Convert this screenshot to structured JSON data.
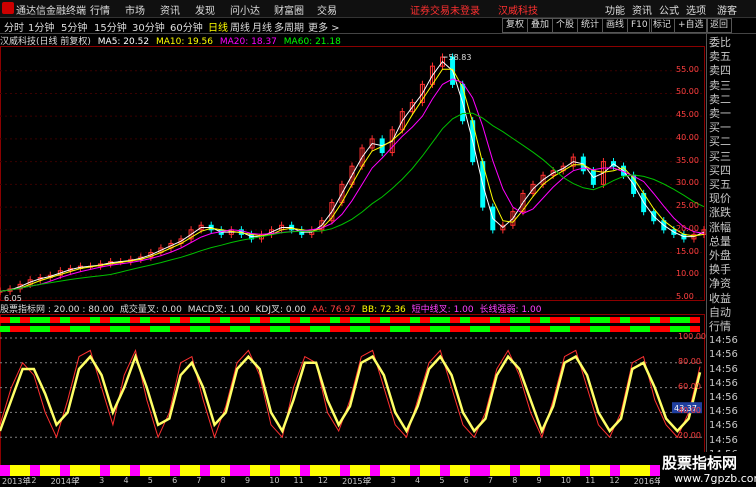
{
  "app": {
    "title": "通达信金融终端",
    "menus": [
      "行情",
      "市场",
      "资讯",
      "发现",
      "问小达",
      "财富圈",
      "交易"
    ],
    "notice": "证券交易未登录",
    "stock_name": "汉威科技",
    "right_menus": [
      "功能",
      "资讯",
      "公式",
      "选项"
    ],
    "guest": "游客"
  },
  "toolbar": {
    "periods": [
      "分时",
      "1分钟",
      "5分钟",
      "15分钟",
      "30分钟",
      "60分钟",
      "日线",
      "周线",
      "月线",
      "多周期",
      "更多 >"
    ],
    "active_period": "日线",
    "right_buttons": [
      "复权",
      "叠加",
      "个股",
      "统计",
      "画线",
      "F10",
      "标记",
      "+自选",
      "返回"
    ]
  },
  "main_header": {
    "stock": "汉威科技(日线 前复权)",
    "ma5": "MA5: 20.52",
    "ma10": "MA10: 19.56",
    "ma20": "MA20: 18.37",
    "ma60": "MA60: 21.18",
    "colors": {
      "ma5": "#ffffff",
      "ma10": "#ffff00",
      "ma20": "#ff00ff",
      "ma60": "#00ff00"
    }
  },
  "price_axis": [
    "55.00",
    "50.00",
    "45.00",
    "40.00",
    "35.00",
    "30.00",
    "25.00",
    "20.00",
    "15.00",
    "10.00",
    "5.00"
  ],
  "high_label": "58.83",
  "low_label": "6.05",
  "sub_header": {
    "title": "股票指标网 : 20.00 : 80.00",
    "volume": "成交量叉: 0.00",
    "macd": "MACD叉: 1.00",
    "kdj": "KDJ叉: 0.00",
    "aa": "AA: 76.97",
    "bb": "BB: 72.36",
    "mid": "短中线叉: 1.00",
    "long": "长线强弱: 1.00"
  },
  "indicator_axis": [
    "100.00",
    "80.00",
    "60.00",
    "40.00",
    "20.00"
  ],
  "indicator_value": "43.37",
  "right_panel": [
    "委比",
    "卖五",
    "卖四",
    "卖三",
    "卖二",
    "卖一",
    "买一",
    "买二",
    "买三",
    "买四",
    "买五",
    "现价",
    "涨跌",
    "涨幅",
    "总量",
    "外盘",
    "换手",
    "净资",
    "收益",
    "自动",
    "行情",
    "14:56",
    "14:56",
    "14:56",
    "14:56",
    "14:56",
    "14:56",
    "14:56",
    "14:56",
    "14:56"
  ],
  "x_axis": [
    "2013年",
    "12",
    "2014年",
    "2",
    "3",
    "4",
    "5",
    "6",
    "7",
    "8",
    "9",
    "10",
    "11",
    "12",
    "2015年",
    "2",
    "3",
    "4",
    "5",
    "6",
    "7",
    "8",
    "9",
    "10",
    "11",
    "12",
    "2016年",
    "2"
  ],
  "watermark": {
    "title": "股票指标网",
    "url": "www.7gpzb.com"
  },
  "chart_data": {
    "type": "line",
    "title": "",
    "price_series": {
      "name": "汉威科技",
      "x": [
        0,
        10,
        20,
        30,
        40,
        50,
        60,
        70,
        80,
        90,
        100,
        110,
        120,
        130,
        140,
        150,
        160,
        170,
        180,
        190,
        200,
        210,
        220,
        230,
        240,
        250,
        260,
        270,
        280,
        290,
        300,
        310,
        320,
        330,
        340,
        350,
        360,
        370,
        380,
        390,
        400,
        410,
        420,
        430,
        440,
        450,
        460,
        470,
        480,
        490,
        500,
        510,
        520,
        530,
        540,
        550,
        560,
        570,
        580,
        590,
        600,
        610,
        620,
        630,
        640,
        650,
        660,
        670,
        680,
        690,
        700
      ],
      "y": [
        6.5,
        7,
        8,
        9,
        9.5,
        10,
        11,
        11.5,
        12,
        12,
        12.5,
        13,
        13,
        13.5,
        14,
        15,
        16,
        17,
        18,
        20,
        21,
        20,
        19,
        20,
        19,
        18,
        19,
        20,
        21,
        20,
        19,
        20,
        22,
        26,
        30,
        34,
        38,
        40,
        37,
        42,
        46,
        48,
        52,
        56,
        58,
        52,
        44,
        35,
        25,
        20,
        21,
        24,
        28,
        30,
        32,
        33,
        34,
        36,
        33,
        30,
        35,
        34,
        32,
        28,
        24,
        22,
        20,
        19,
        18,
        19,
        20
      ]
    },
    "indicator_series": [
      {
        "name": "AA",
        "values": [
          30,
          60,
          80,
          70,
          40,
          20,
          50,
          85,
          90,
          60,
          30,
          70,
          90,
          50,
          20,
          40,
          80,
          85,
          50,
          20,
          45,
          80,
          90,
          70,
          30,
          20,
          60,
          85,
          80,
          40,
          25,
          50,
          85,
          90,
          60,
          30,
          20,
          50,
          80,
          90,
          60,
          30,
          20,
          40,
          75,
          90,
          70,
          40,
          20,
          50,
          85,
          90,
          60,
          30,
          20,
          40,
          80,
          85,
          50,
          30,
          20,
          40,
          76.97
        ]
      },
      {
        "name": "BB",
        "values": [
          25,
          50,
          75,
          75,
          55,
          30,
          40,
          75,
          85,
          70,
          40,
          60,
          85,
          60,
          30,
          35,
          70,
          80,
          60,
          30,
          40,
          75,
          85,
          75,
          40,
          25,
          50,
          80,
          80,
          50,
          30,
          45,
          80,
          85,
          70,
          40,
          25,
          45,
          75,
          85,
          70,
          40,
          25,
          35,
          70,
          85,
          75,
          50,
          25,
          45,
          80,
          85,
          70,
          40,
          25,
          35,
          75,
          80,
          60,
          35,
          25,
          35,
          72.36
        ]
      }
    ],
    "ylim": [
      5,
      60
    ],
    "indicator_ylim": [
      0,
      100
    ],
    "grid": true
  }
}
